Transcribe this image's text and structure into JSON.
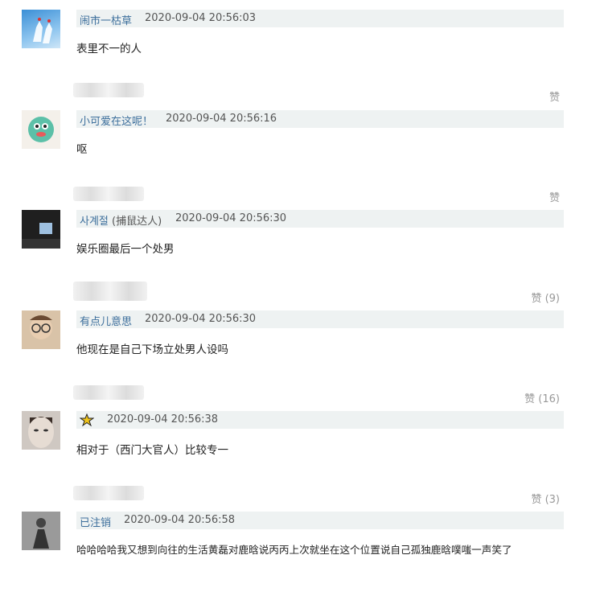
{
  "comments": [
    {
      "name": "闹市一枯草",
      "tag": "",
      "time": "2020-09-04 20:56:03",
      "text": "表里不一的人",
      "likes": "赞"
    },
    {
      "name": "小可爱在这呢！",
      "tag": "",
      "time": "2020-09-04 20:56:16",
      "text": "呕",
      "likes": "赞"
    },
    {
      "name": "사계절",
      "tag": "(捕鼠达人)",
      "time": "2020-09-04 20:56:30",
      "text": "娱乐圈最后一个处男",
      "likes": "赞 (9)"
    },
    {
      "name": "有点儿意思",
      "tag": "",
      "time": "2020-09-04 20:56:30",
      "text": "他现在是自己下场立处男人设吗",
      "likes": "赞 (16)"
    },
    {
      "name": "",
      "tag": "",
      "time": "2020-09-04 20:56:38",
      "text": "相对于（西门大官人）比较专一",
      "likes": "赞 (3)"
    },
    {
      "name": "已注销",
      "tag": "",
      "time": "2020-09-04 20:56:58",
      "text": "哈哈哈哈我又想到向往的生活黄磊对鹿晗说丙丙上次就坐在这个位置说自己孤独鹿晗噗嗤一声笑了",
      "likes": ""
    }
  ]
}
